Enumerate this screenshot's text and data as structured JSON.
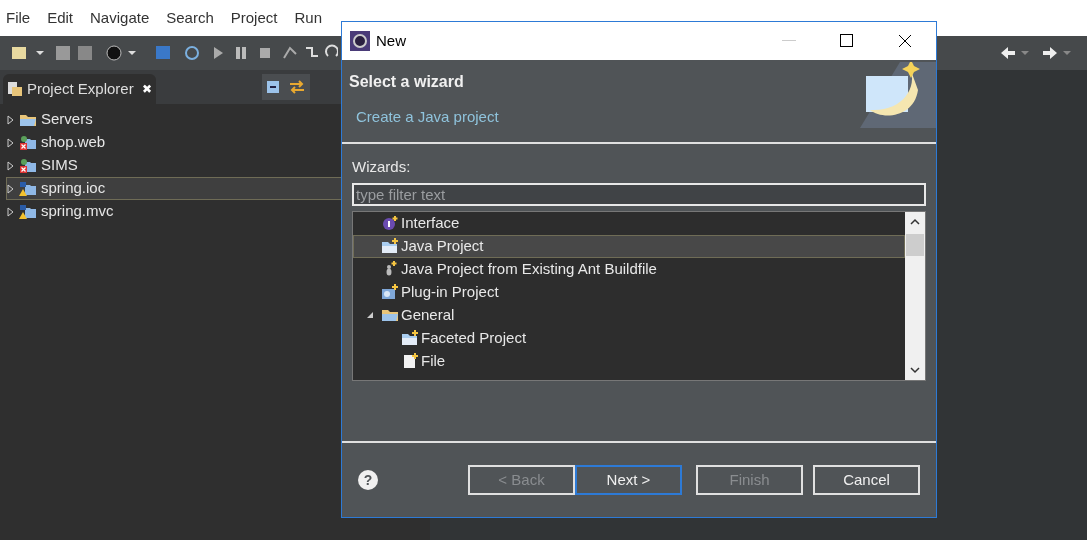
{
  "menu": [
    "File",
    "Edit",
    "Navigate",
    "Search",
    "Project",
    "Run"
  ],
  "explorer": {
    "title": "Project Explorer",
    "close": "✖",
    "items": [
      {
        "label": "Servers",
        "kind": "folder",
        "selected": false
      },
      {
        "label": "shop.web",
        "kind": "error",
        "selected": false
      },
      {
        "label": "SIMS",
        "kind": "error",
        "selected": false
      },
      {
        "label": "spring.ioc",
        "kind": "warning",
        "selected": true
      },
      {
        "label": "spring.mvc",
        "kind": "warning",
        "selected": false
      }
    ]
  },
  "dialog": {
    "title": "New",
    "heading": "Select a wizard",
    "description": "Create a Java project",
    "wizards_label": "Wizards:",
    "filter": {
      "placeholder": "type filter text"
    },
    "wizards": [
      {
        "label": "Interface",
        "kind": "interface",
        "selected": false
      },
      {
        "label": "Java Project",
        "kind": "project",
        "selected": true
      },
      {
        "label": "Java Project from Existing Ant Buildfile",
        "kind": "ant",
        "selected": false
      },
      {
        "label": "Plug-in Project",
        "kind": "plugin",
        "selected": false
      },
      {
        "label": "General",
        "kind": "folder",
        "selected": false,
        "expanded": true,
        "children": [
          {
            "label": "Faceted Project",
            "kind": "project",
            "selected": false
          },
          {
            "label": "File",
            "kind": "file",
            "selected": false
          }
        ]
      }
    ],
    "help": "?",
    "buttons": [
      {
        "label": "< Back",
        "disabled": true,
        "default": false
      },
      {
        "label": "Next >",
        "disabled": false,
        "default": true
      },
      {
        "label": "Finish",
        "disabled": true,
        "default": false
      },
      {
        "label": "Cancel",
        "disabled": false,
        "default": false
      }
    ]
  }
}
